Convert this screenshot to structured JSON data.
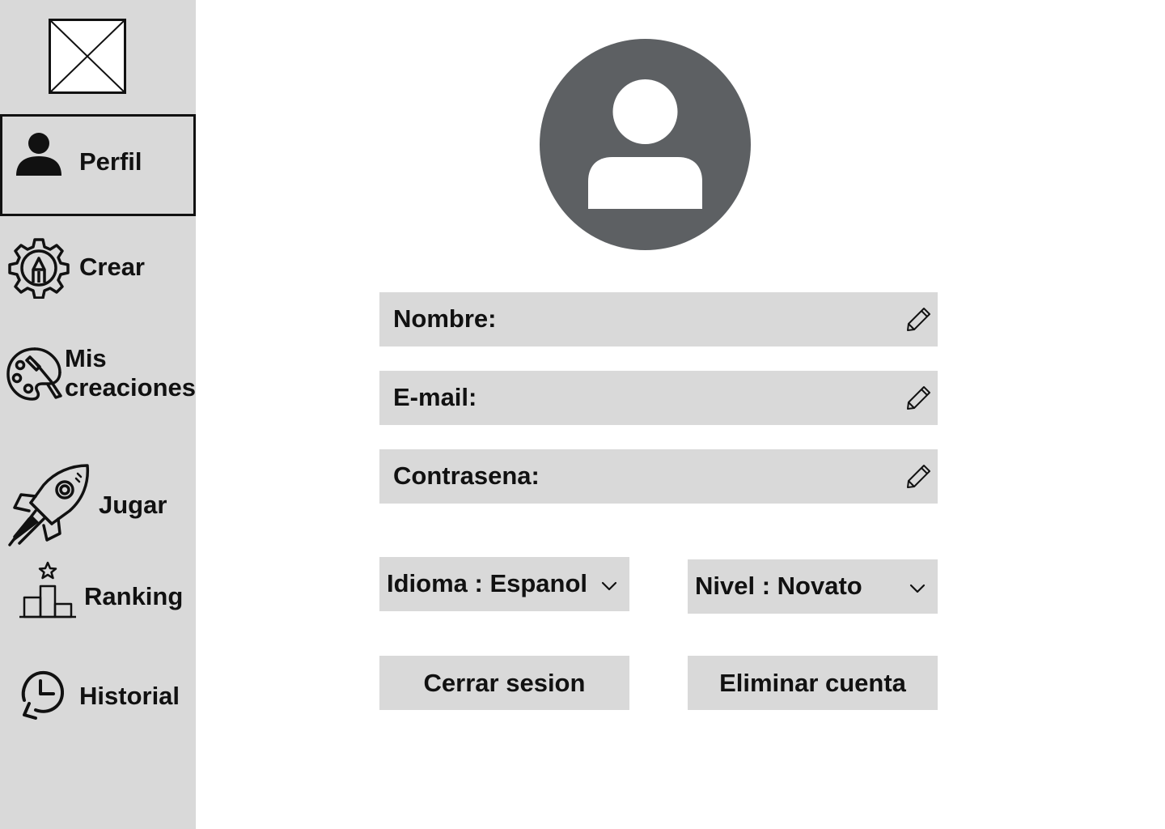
{
  "sidebar": {
    "logo_icon": "image-placeholder-icon",
    "items": [
      {
        "label": "Perfil",
        "icon": "user-icon",
        "active": true
      },
      {
        "label": "Crear",
        "icon": "gear-pencil-icon"
      },
      {
        "label_line1": "Mis",
        "label_line2": "creaciones",
        "icon": "palette-brush-icon"
      },
      {
        "label": "Jugar",
        "icon": "rocket-icon"
      },
      {
        "label": "Ranking",
        "icon": "podium-star-icon"
      },
      {
        "label": "Historial",
        "icon": "history-clock-icon"
      }
    ]
  },
  "profile": {
    "avatar_icon": "user-avatar-icon",
    "fields": [
      {
        "label": "Nombre:",
        "action_icon": "pencil-icon"
      },
      {
        "label": "E-mail:",
        "action_icon": "pencil-icon"
      },
      {
        "label": "Contrasena:",
        "action_icon": "pencil-icon"
      }
    ],
    "language_select": {
      "label": "Idioma : Espanol"
    },
    "level_select": {
      "label": "Nivel : Novato"
    },
    "logout_label": "Cerrar sesion",
    "delete_account_label": "Eliminar cuenta"
  },
  "colors": {
    "sidebar_bg": "#d9d9d9",
    "field_bg": "#d9d9d9",
    "avatar_bg": "#5d6063",
    "text": "#111111"
  }
}
